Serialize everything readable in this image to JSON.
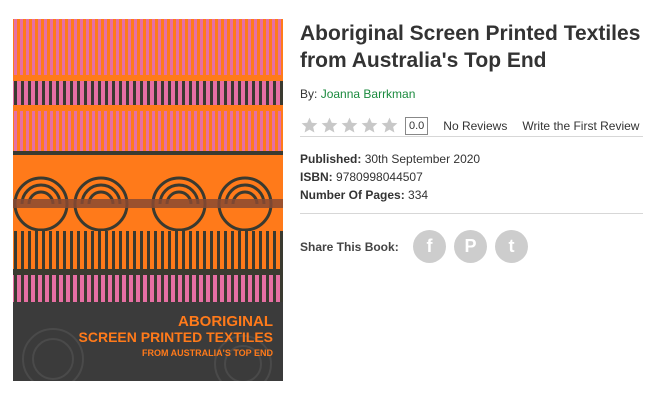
{
  "book": {
    "title": "Aboriginal Screen Printed Textiles from Australia's Top End",
    "by_label": "By:",
    "author": "Joanna Barrkman",
    "rating_value": "0.0",
    "stars_filled": 0,
    "stars_total": 5,
    "reviews_label": "No Reviews",
    "write_review_label": "Write the First Review",
    "published_label": "Published:",
    "published_value": "30th September 2020",
    "isbn_label": "ISBN:",
    "isbn_value": "9780998044507",
    "pages_label": "Number Of Pages:",
    "pages_value": "334"
  },
  "share": {
    "label": "Share This Book:",
    "buttons": [
      {
        "icon": "facebook-icon",
        "glyph": "f"
      },
      {
        "icon": "pinterest-icon",
        "glyph": "P"
      },
      {
        "icon": "twitter-icon",
        "glyph": "t"
      }
    ]
  },
  "cover": {
    "line1": "ABORIGINAL",
    "line2": "SCREEN PRINTED TEXTILES",
    "line3": "FROM AUSTRALIA'S TOP END",
    "colors": {
      "orange": "#ff7a1a",
      "pink": "#e66fa4",
      "dark": "#3a3a30",
      "footer": "#3b3b3b"
    }
  },
  "colors": {
    "author_link": "#1b8a3e",
    "star_empty": "#c8c8c8",
    "share_button": "#cdcdcd"
  }
}
